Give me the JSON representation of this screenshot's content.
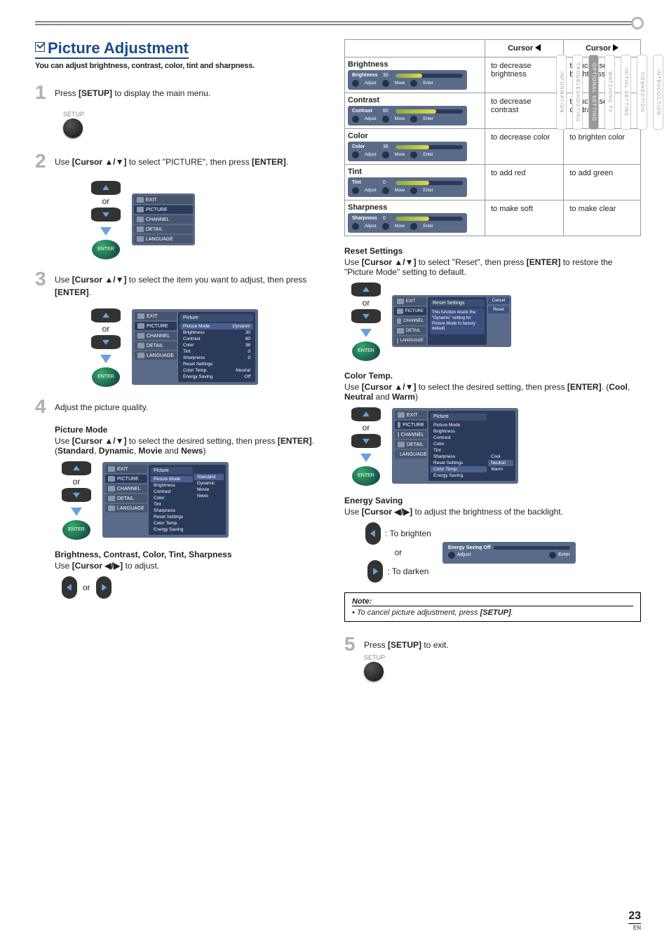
{
  "page_number": "23",
  "page_locale": "EN",
  "header": {
    "checkmark": true,
    "title": "Picture Adjustment",
    "subtitle": "You can adjust brightness, contrast, color, tint and sharpness."
  },
  "side_tabs": [
    "INTRODUCTION",
    "CONNECTION",
    "INITIAL SETTING",
    "WATCHING TV",
    "OPTIONAL SETTING",
    "TROUBLESHOOTING",
    "INFORMATION"
  ],
  "active_side_tab_index": 4,
  "steps": [
    {
      "num": "1",
      "text_parts": [
        "Press ",
        "[SETUP]",
        " to display the main menu."
      ]
    },
    {
      "num": "2",
      "text_parts": [
        "Use ",
        "[Cursor ▲/▼]",
        " to select \"PICTURE\", then press ",
        "[ENTER]",
        "."
      ]
    },
    {
      "num": "3",
      "text_parts": [
        "Use ",
        "[Cursor ▲/▼]",
        " to select the item you want to adjust, then press ",
        "[ENTER]",
        "."
      ]
    },
    {
      "num": "4",
      "text_parts": [
        "Adjust the picture quality."
      ]
    },
    {
      "num": "5",
      "text_parts": [
        "Press ",
        "[SETUP]",
        " to exit."
      ]
    }
  ],
  "setup_label": "SETUP",
  "enter_label": "ENTER",
  "or_label": "or",
  "left_col_sections": {
    "picture_mode": {
      "heading": "Picture Mode",
      "text_parts": [
        "Use ",
        "[Cursor ▲/▼]",
        " to select the desired setting, then press ",
        "[ENTER]",
        ". (",
        "Standard",
        ", ",
        "Dynamic",
        ", ",
        "Movie",
        " and ",
        "News",
        ")"
      ]
    },
    "bccts": {
      "heading": "Brightness, Contrast, Color, Tint, Sharpness",
      "text_parts": [
        "Use ",
        "[Cursor ◀/▶]",
        " to adjust."
      ]
    }
  },
  "menu_sidebar_items": [
    "EXIT",
    "PICTURE",
    "CHANNEL",
    "DETAIL",
    "LANGUAGE"
  ],
  "picture_menu": {
    "header": "Picture",
    "rows": [
      [
        "Picture Mode",
        "Dynamic"
      ],
      [
        "Brightness",
        "30"
      ],
      [
        "Contrast",
        "60"
      ],
      [
        "Color",
        "36"
      ],
      [
        "Tint",
        "0"
      ],
      [
        "Sharpness",
        "0"
      ],
      [
        "Reset Settings",
        ""
      ],
      [
        "Color Temp.",
        "Neutral"
      ],
      [
        "Energy Saving",
        "Off"
      ]
    ]
  },
  "picture_mode_menu": {
    "header": "Picture",
    "left_col": [
      "Picture Mode",
      "Brightness",
      "Contrast",
      "Color",
      "Tint",
      "Sharpness",
      "Reset Settings",
      "Color Temp.",
      "Energy Saving"
    ],
    "right_col": [
      "Standard",
      "Dynamic",
      "Movie",
      "News"
    ]
  },
  "slider_controls": [
    "Adjust",
    "Move",
    "Enter"
  ],
  "adjust_table": {
    "headers": [
      "",
      "Cursor ◀",
      "Cursor ▶"
    ],
    "rows": [
      {
        "param": "Brightness",
        "slider_label": "Brightness",
        "slider_val": "30",
        "fill": 40,
        "left": "to decrease brightness",
        "right": "to increase brightness"
      },
      {
        "param": "Contrast",
        "slider_label": "Contrast",
        "slider_val": "60",
        "fill": 60,
        "left": "to decrease contrast",
        "right": "to increase contrast"
      },
      {
        "param": "Color",
        "slider_label": "Color",
        "slider_val": "36",
        "fill": 50,
        "left": "to decrease color",
        "right": "to brighten color"
      },
      {
        "param": "Tint",
        "slider_label": "Tint",
        "slider_val": "0",
        "fill": 50,
        "left": "to add red",
        "right": "to add green"
      },
      {
        "param": "Sharpness",
        "slider_label": "Sharpness",
        "slider_val": "0",
        "fill": 50,
        "left": "to make soft",
        "right": "to make clear"
      }
    ]
  },
  "reset_settings": {
    "heading": "Reset Settings",
    "text_parts": [
      "Use ",
      "[Cursor ▲/▼]",
      " to select \"Reset\", then press ",
      "[ENTER]",
      " to restore the \"Picture Mode\" setting to default."
    ],
    "panel_header": "Reset Settings",
    "panel_message": "This function resets the \"Dynamic\" setting for Picture Mode to factory default.",
    "options": [
      "Cancel",
      "Reset"
    ]
  },
  "color_temp": {
    "heading": "Color Temp.",
    "text_parts": [
      "Use ",
      "[Cursor ▲/▼]",
      " to select the desired setting, then press ",
      "[ENTER]",
      ". (",
      "Cool",
      ", ",
      "Neutral",
      " and ",
      "Warm",
      ")"
    ],
    "menu_header": "Picture",
    "left_col": [
      "Picture Mode",
      "Brightness",
      "Contrast",
      "Color",
      "Tint",
      "Sharpness",
      "Reset Settings",
      "Color Temp.",
      "Energy Saving"
    ],
    "right_col": [
      "Cool",
      "Neutral",
      "Warm"
    ]
  },
  "energy_saving": {
    "heading": "Energy Saving",
    "text_parts": [
      "Use ",
      "[Cursor ◀/▶]",
      " to adjust the brightness of the backlight."
    ],
    "brighten": ": To brighten",
    "darken": ": To darken",
    "bar_label": "Energy Saving  Off",
    "bar_ctrl": [
      "Adjust",
      "Enter"
    ]
  },
  "note": {
    "header": "Note:",
    "bullet_parts": [
      "• ",
      "To cancel picture adjustment, press ",
      "[SETUP]",
      "."
    ]
  }
}
